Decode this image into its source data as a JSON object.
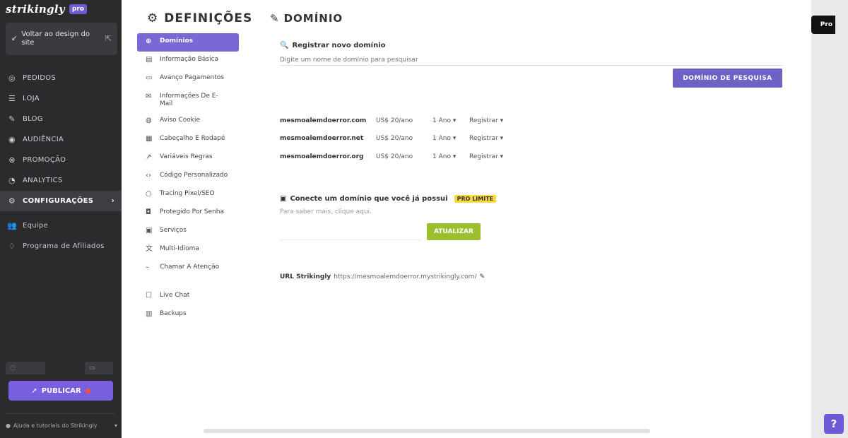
{
  "sidebar": {
    "logo": "strikingly",
    "logo_badge": "pro",
    "back_to_design": "Voltar ao design do site",
    "nav": [
      {
        "label": "PEDIDOS",
        "icon": "orders-icon"
      },
      {
        "label": "LOJA",
        "icon": "store-icon"
      },
      {
        "label": "BLOG",
        "icon": "blog-icon"
      },
      {
        "label": "AUDIÊNCIA",
        "icon": "audience-icon"
      },
      {
        "label": "PROMOÇÃO",
        "icon": "promotion-icon"
      },
      {
        "label": "ANALYTICS",
        "icon": "analytics-icon"
      },
      {
        "label": "CONFIGURAÇÕES",
        "icon": "settings-icon"
      }
    ],
    "sub_items": [
      {
        "label": "Equipe",
        "icon": "team-icon"
      },
      {
        "label": "Programa de Afiliados",
        "icon": "affiliate-icon"
      }
    ],
    "tool_left": "",
    "tool_right": "",
    "publish_label": "PUBLICAR",
    "footer_note": "Ajuda e tutoriais do Strikingly"
  },
  "settings": {
    "title": "DEFINIÇÕES",
    "menu": [
      {
        "label": "Domínios",
        "icon": "globe-icon"
      },
      {
        "label": "Informação Básica",
        "icon": "info-icon"
      },
      {
        "label": "Avanço Pagamentos",
        "icon": "card-icon"
      },
      {
        "label": "Informações De E-Mail",
        "icon": "mail-icon"
      },
      {
        "label": "Aviso Cookie",
        "icon": "cookie-icon"
      },
      {
        "label": "Cabeçalho E Rodapé",
        "icon": "layout-icon"
      },
      {
        "label": "Variáveis Regras",
        "icon": "rules-icon"
      },
      {
        "label": "Código Personalizado",
        "icon": "code-icon"
      },
      {
        "label": "Tracing Pixel/SEO",
        "icon": "pixel-icon"
      },
      {
        "label": "Protegido Por Senha",
        "icon": "lock-icon"
      },
      {
        "label": "Serviços",
        "icon": "services-icon"
      },
      {
        "label": "Multi-Idioma",
        "icon": "language-icon"
      },
      {
        "label": "Chamar A Atenção",
        "icon": "megaphone-icon"
      }
    ],
    "menu_bottom": [
      {
        "label": "Live Chat",
        "icon": "chat-icon"
      },
      {
        "label": "Backups",
        "icon": "backup-icon"
      }
    ]
  },
  "domain": {
    "title": "DOMÍNIO",
    "register_heading": "Registrar novo domínio",
    "search_placeholder": "Digite um nome de domínio para pesquisar",
    "search_button": "DOMÍNIO DE PESQUISA",
    "suggestions_label": "",
    "rows": [
      {
        "name": "mesmoalemdoerror.com",
        "price": "US$ 20/ano",
        "term": "1 Ano ▾",
        "action": "Registrar ▾"
      },
      {
        "name": "mesmoalemdoerror.net",
        "price": "US$ 20/ano",
        "term": "1 Ano ▾",
        "action": "Registrar ▾"
      },
      {
        "name": "mesmoalemdoerror.org",
        "price": "US$ 20/ano",
        "term": "1 Ano ▾",
        "action": "Registrar ▾"
      }
    ],
    "connect_heading": "Conecte um domínio que você já possui",
    "connect_badge": "PRO LIMITE",
    "connect_sub": "Para saber mais, clique aqui.",
    "connect_input_placeholder": "",
    "connect_button": "ATUALIZAR",
    "subdomain_label": "URL Strikingly",
    "subdomain_url": "https://mesmoalemdoerror.mystrikingly.com/"
  },
  "right": {
    "pro_label": "Pro",
    "help_label": "?"
  },
  "colors": {
    "accent": "#7b68d6",
    "connect_button": "#9bbf2e",
    "badge": "#ffd93a",
    "sidebar_bg": "#2b2b2e"
  }
}
